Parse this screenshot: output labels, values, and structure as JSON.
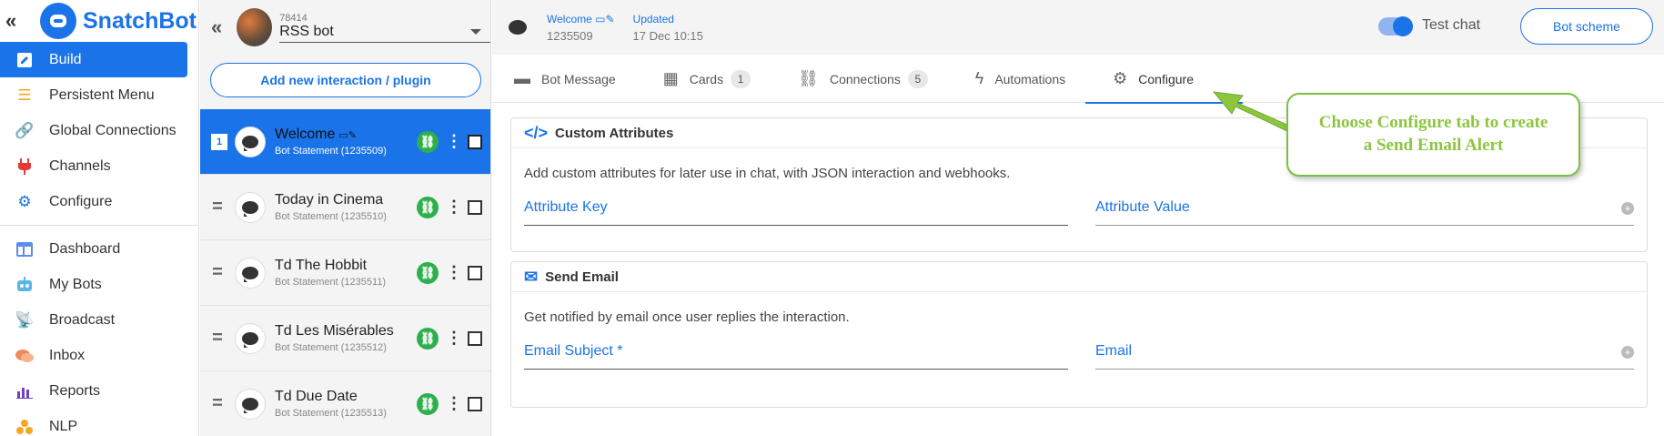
{
  "brand": {
    "name": "SnatchBot",
    "collapse_icon": "double-chevron-left"
  },
  "nav": {
    "items": [
      {
        "label": "Build",
        "icon": "edit-icon",
        "active": true
      },
      {
        "label": "Persistent Menu",
        "icon": "menu-icon"
      },
      {
        "label": "Global Connections",
        "icon": "link-icon"
      },
      {
        "label": "Channels",
        "icon": "plug-icon"
      },
      {
        "label": "Configure",
        "icon": "gear-icon"
      },
      {
        "label": "Dashboard",
        "icon": "dashboard-icon"
      },
      {
        "label": "My Bots",
        "icon": "robot-icon"
      },
      {
        "label": "Broadcast",
        "icon": "broadcast-icon"
      },
      {
        "label": "Inbox",
        "icon": "chat-icon"
      },
      {
        "label": "Reports",
        "icon": "chart-icon"
      },
      {
        "label": "NLP",
        "icon": "nlp-icon"
      }
    ]
  },
  "bot": {
    "id": "78414",
    "name": "RSS bot"
  },
  "add_button": "Add new interaction / plugin",
  "interactions": [
    {
      "badge": "1",
      "title": "Welcome",
      "sub": "Bot Statement (1235509)",
      "selected": true
    },
    {
      "title": "Today in Cinema",
      "sub": "Bot Statement (1235510)"
    },
    {
      "title": "Td The Hobbit",
      "sub": "Bot Statement (1235511)"
    },
    {
      "title": "Td Les Misérables",
      "sub": "Bot Statement (1235512)"
    },
    {
      "title": "Td Due Date",
      "sub": "Bot Statement (1235513)"
    }
  ],
  "topbar": {
    "title": "Welcome",
    "id": "1235509",
    "updated_label": "Updated",
    "updated_value": "17 Dec 10:15",
    "test_chat": "Test chat",
    "scheme_button": "Bot scheme"
  },
  "tabs": [
    {
      "label": "Bot Message",
      "icon": "message-icon"
    },
    {
      "label": "Cards",
      "icon": "grid-icon",
      "count": "1"
    },
    {
      "label": "Connections",
      "icon": "link-icon",
      "count": "5"
    },
    {
      "label": "Automations",
      "icon": "bolt-icon"
    },
    {
      "label": "Configure",
      "icon": "gear-icon",
      "active": true
    }
  ],
  "custom_attributes": {
    "title": "Custom Attributes",
    "description": "Add custom attributes for later use in chat, with JSON interaction and webhooks.",
    "key_placeholder": "Attribute Key",
    "value_placeholder": "Attribute Value"
  },
  "send_email": {
    "title": "Send Email",
    "description": "Get notified by email once user replies the interaction.",
    "subject_placeholder": "Email Subject *",
    "email_placeholder": "Email"
  },
  "callout": {
    "line1": "Choose Configure tab to create",
    "line2": "a Send Email Alert"
  },
  "colors": {
    "accent": "#1a73e8",
    "callout": "#8cc63f",
    "link_green": "#2db04c"
  }
}
